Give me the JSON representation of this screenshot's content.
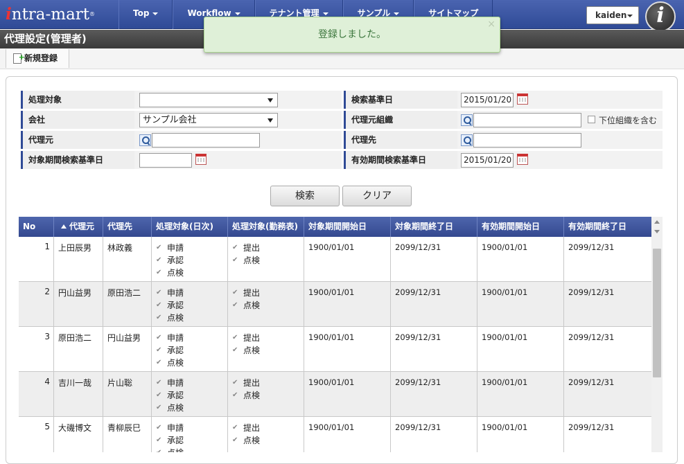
{
  "nav": {
    "logo": "ntra-mart",
    "logo_mark": "i",
    "logo_tm": "®",
    "items": [
      {
        "label": "Top",
        "has_caret": true
      },
      {
        "label": "Workflow",
        "has_caret": true
      },
      {
        "label": "テナント管理",
        "has_caret": true
      },
      {
        "label": "サンプル",
        "has_caret": true
      },
      {
        "label": "サイトマップ",
        "has_caret": false
      }
    ],
    "user": "kaiden",
    "avatar_letter": "i"
  },
  "page": {
    "title": "代理設定(管理者)",
    "new_button": "新規登録"
  },
  "toast": {
    "message": "登録しました。",
    "close": "×"
  },
  "search": {
    "target_label": "処理対象",
    "target_value": "",
    "base_date_label": "検索基準日",
    "base_date_value": "2015/01/20",
    "company_label": "会社",
    "company_value": "サンプル会社",
    "source_org_label": "代理元組織",
    "source_org_value": "",
    "include_sub_label": "下位組織を含む",
    "source_label": "代理元",
    "source_value": "",
    "dest_label": "代理先",
    "dest_value": "",
    "period_base_label": "対象期間検索基準日",
    "period_base_value": "",
    "valid_base_label": "有効期間検索基準日",
    "valid_base_value": "2015/01/20",
    "search_button": "検索",
    "clear_button": "クリア"
  },
  "grid": {
    "headers": [
      "No",
      "代理元",
      "代理先",
      "処理対象(日次)",
      "処理対象(勤務表)",
      "対象期間開始日",
      "対象期間終了日",
      "有効期間開始日",
      "有効期間終了日"
    ],
    "rows": [
      {
        "no": "1",
        "src": "上田辰男",
        "dst": "林政義",
        "daily": [
          "申請",
          "承認",
          "点検"
        ],
        "sheet": [
          "提出",
          "点検"
        ],
        "ps": "1900/01/01",
        "pe": "2099/12/31",
        "vs": "1900/01/01",
        "ve": "2099/12/31"
      },
      {
        "no": "2",
        "src": "円山益男",
        "dst": "原田浩二",
        "daily": [
          "申請",
          "承認",
          "点検"
        ],
        "sheet": [
          "提出",
          "点検"
        ],
        "ps": "1900/01/01",
        "pe": "2099/12/31",
        "vs": "1900/01/01",
        "ve": "2099/12/31"
      },
      {
        "no": "3",
        "src": "原田浩二",
        "dst": "円山益男",
        "daily": [
          "申請",
          "承認",
          "点検"
        ],
        "sheet": [
          "提出",
          "点検"
        ],
        "ps": "1900/01/01",
        "pe": "2099/12/31",
        "vs": "1900/01/01",
        "ve": "2099/12/31"
      },
      {
        "no": "4",
        "src": "吉川一哉",
        "dst": "片山聡",
        "daily": [
          "申請",
          "承認",
          "点検"
        ],
        "sheet": [
          "提出",
          "点検"
        ],
        "ps": "1900/01/01",
        "pe": "2099/12/31",
        "vs": "1900/01/01",
        "ve": "2099/12/31"
      },
      {
        "no": "5",
        "src": "大磯博文",
        "dst": "青柳辰巳",
        "daily": [
          "申請",
          "承認",
          "点検"
        ],
        "sheet": [
          "提出",
          "点検"
        ],
        "ps": "1900/01/01",
        "pe": "2099/12/31",
        "vs": "1900/01/01",
        "ve": "2099/12/31"
      }
    ]
  },
  "colors": {
    "nav": "#2f4a96",
    "toast_bg": "#dff0d8",
    "toast_text": "#3c763d",
    "title_bar": "#444444"
  }
}
